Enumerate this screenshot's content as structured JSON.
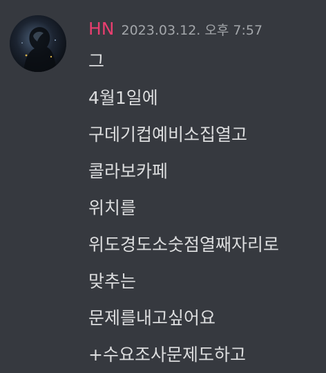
{
  "message": {
    "author": "HN",
    "timestamp": "2023.03.12. 오후 7:57",
    "avatar_icon": "user-avatar",
    "author_color": "#e83e6f",
    "lines": [
      "그",
      "4월1일에",
      "구데기컵예비소집열고",
      "콜라보카페",
      "위치를",
      "위도경도소숫점열째자리로",
      "맞추는",
      "문제를내고싶어요",
      "+수요조사문제도하고"
    ]
  }
}
